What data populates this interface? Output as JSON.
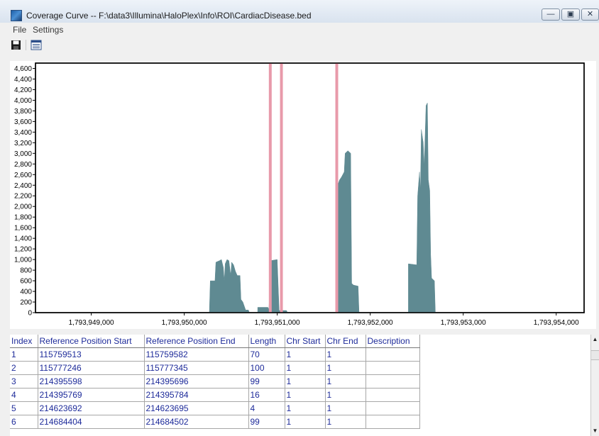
{
  "window": {
    "title": "Coverage Curve -- F:\\data3\\Illumina\\HaloPlex\\Info\\ROI\\CardiacDisease.bed"
  },
  "menu": [
    "File",
    "Settings"
  ],
  "toolbar": [
    {
      "icon": "save-icon"
    },
    {
      "icon": "table-icon"
    }
  ],
  "chart_data": {
    "type": "area",
    "title": "",
    "xlabel": "",
    "ylabel": "",
    "xlim": [
      1793948400,
      1793954300
    ],
    "ylim": [
      0,
      4700
    ],
    "y_ticks": [
      0,
      200,
      400,
      600,
      800,
      1000,
      1200,
      1400,
      1600,
      1800,
      2000,
      2200,
      2400,
      2600,
      2800,
      3000,
      3200,
      3400,
      3600,
      3800,
      4000,
      4200,
      4400,
      4600
    ],
    "x_ticks": [
      1793949000,
      1793950000,
      1793951000,
      1793952000,
      1793953000,
      1793954000
    ],
    "series": [
      {
        "color": "#5f8a92",
        "points": [
          [
            1793950270,
            0
          ],
          [
            1793950280,
            600
          ],
          [
            1793950330,
            600
          ],
          [
            1793950340,
            950
          ],
          [
            1793950380,
            980
          ],
          [
            1793950400,
            1000
          ],
          [
            1793950420,
            850
          ],
          [
            1793950430,
            600
          ],
          [
            1793950440,
            920
          ],
          [
            1793950460,
            1000
          ],
          [
            1793950480,
            980
          ],
          [
            1793950500,
            700
          ],
          [
            1793950510,
            950
          ],
          [
            1793950530,
            900
          ],
          [
            1793950550,
            780
          ],
          [
            1793950570,
            700
          ],
          [
            1793950600,
            700
          ],
          [
            1793950610,
            250
          ],
          [
            1793950630,
            200
          ],
          [
            1793950660,
            50
          ],
          [
            1793950690,
            50
          ],
          [
            1793950700,
            0
          ],
          [
            1793950790,
            0
          ],
          [
            1793950790,
            100
          ],
          [
            1793950900,
            100
          ],
          [
            1793950910,
            60
          ],
          [
            1793950930,
            980
          ],
          [
            1793951000,
            1000
          ],
          [
            1793951020,
            40
          ],
          [
            1793951100,
            40
          ],
          [
            1793951110,
            0
          ],
          [
            1793951640,
            0
          ],
          [
            1793951650,
            2400
          ],
          [
            1793951670,
            2500
          ],
          [
            1793951690,
            2550
          ],
          [
            1793951720,
            2650
          ],
          [
            1793951730,
            3000
          ],
          [
            1793951760,
            3050
          ],
          [
            1793951790,
            3000
          ],
          [
            1793951800,
            550
          ],
          [
            1793951820,
            520
          ],
          [
            1793951870,
            500
          ],
          [
            1793951880,
            0
          ],
          [
            1793952410,
            0
          ],
          [
            1793952410,
            920
          ],
          [
            1793952500,
            900
          ],
          [
            1793952510,
            2200
          ],
          [
            1793952530,
            2650
          ],
          [
            1793952540,
            2300
          ],
          [
            1793952550,
            3450
          ],
          [
            1793952570,
            3200
          ],
          [
            1793952580,
            2750
          ],
          [
            1793952600,
            3900
          ],
          [
            1793952615,
            3950
          ],
          [
            1793952625,
            2500
          ],
          [
            1793952640,
            2300
          ],
          [
            1793952650,
            1100
          ],
          [
            1793952660,
            650
          ],
          [
            1793952690,
            600
          ],
          [
            1793952700,
            0
          ]
        ]
      }
    ],
    "markers": [
      {
        "x": 1793950925,
        "color": "#e89aaa"
      },
      {
        "x": 1793951045,
        "color": "#e89aaa"
      },
      {
        "x": 1793951640,
        "color": "#e89aaa"
      }
    ]
  },
  "table": {
    "columns": [
      "Index",
      "Reference Position Start",
      "Reference Position End",
      "Length",
      "Chr Start",
      "Chr End",
      "Description"
    ],
    "rows": [
      [
        "1",
        "115759513",
        "115759582",
        "70",
        "1",
        "1",
        ""
      ],
      [
        "2",
        "115777246",
        "115777345",
        "100",
        "1",
        "1",
        ""
      ],
      [
        "3",
        "214395598",
        "214395696",
        "99",
        "1",
        "1",
        ""
      ],
      [
        "4",
        "214395769",
        "214395784",
        "16",
        "1",
        "1",
        ""
      ],
      [
        "5",
        "214623692",
        "214623695",
        "4",
        "1",
        "1",
        ""
      ],
      [
        "6",
        "214684404",
        "214684502",
        "99",
        "1",
        "1",
        ""
      ]
    ]
  }
}
